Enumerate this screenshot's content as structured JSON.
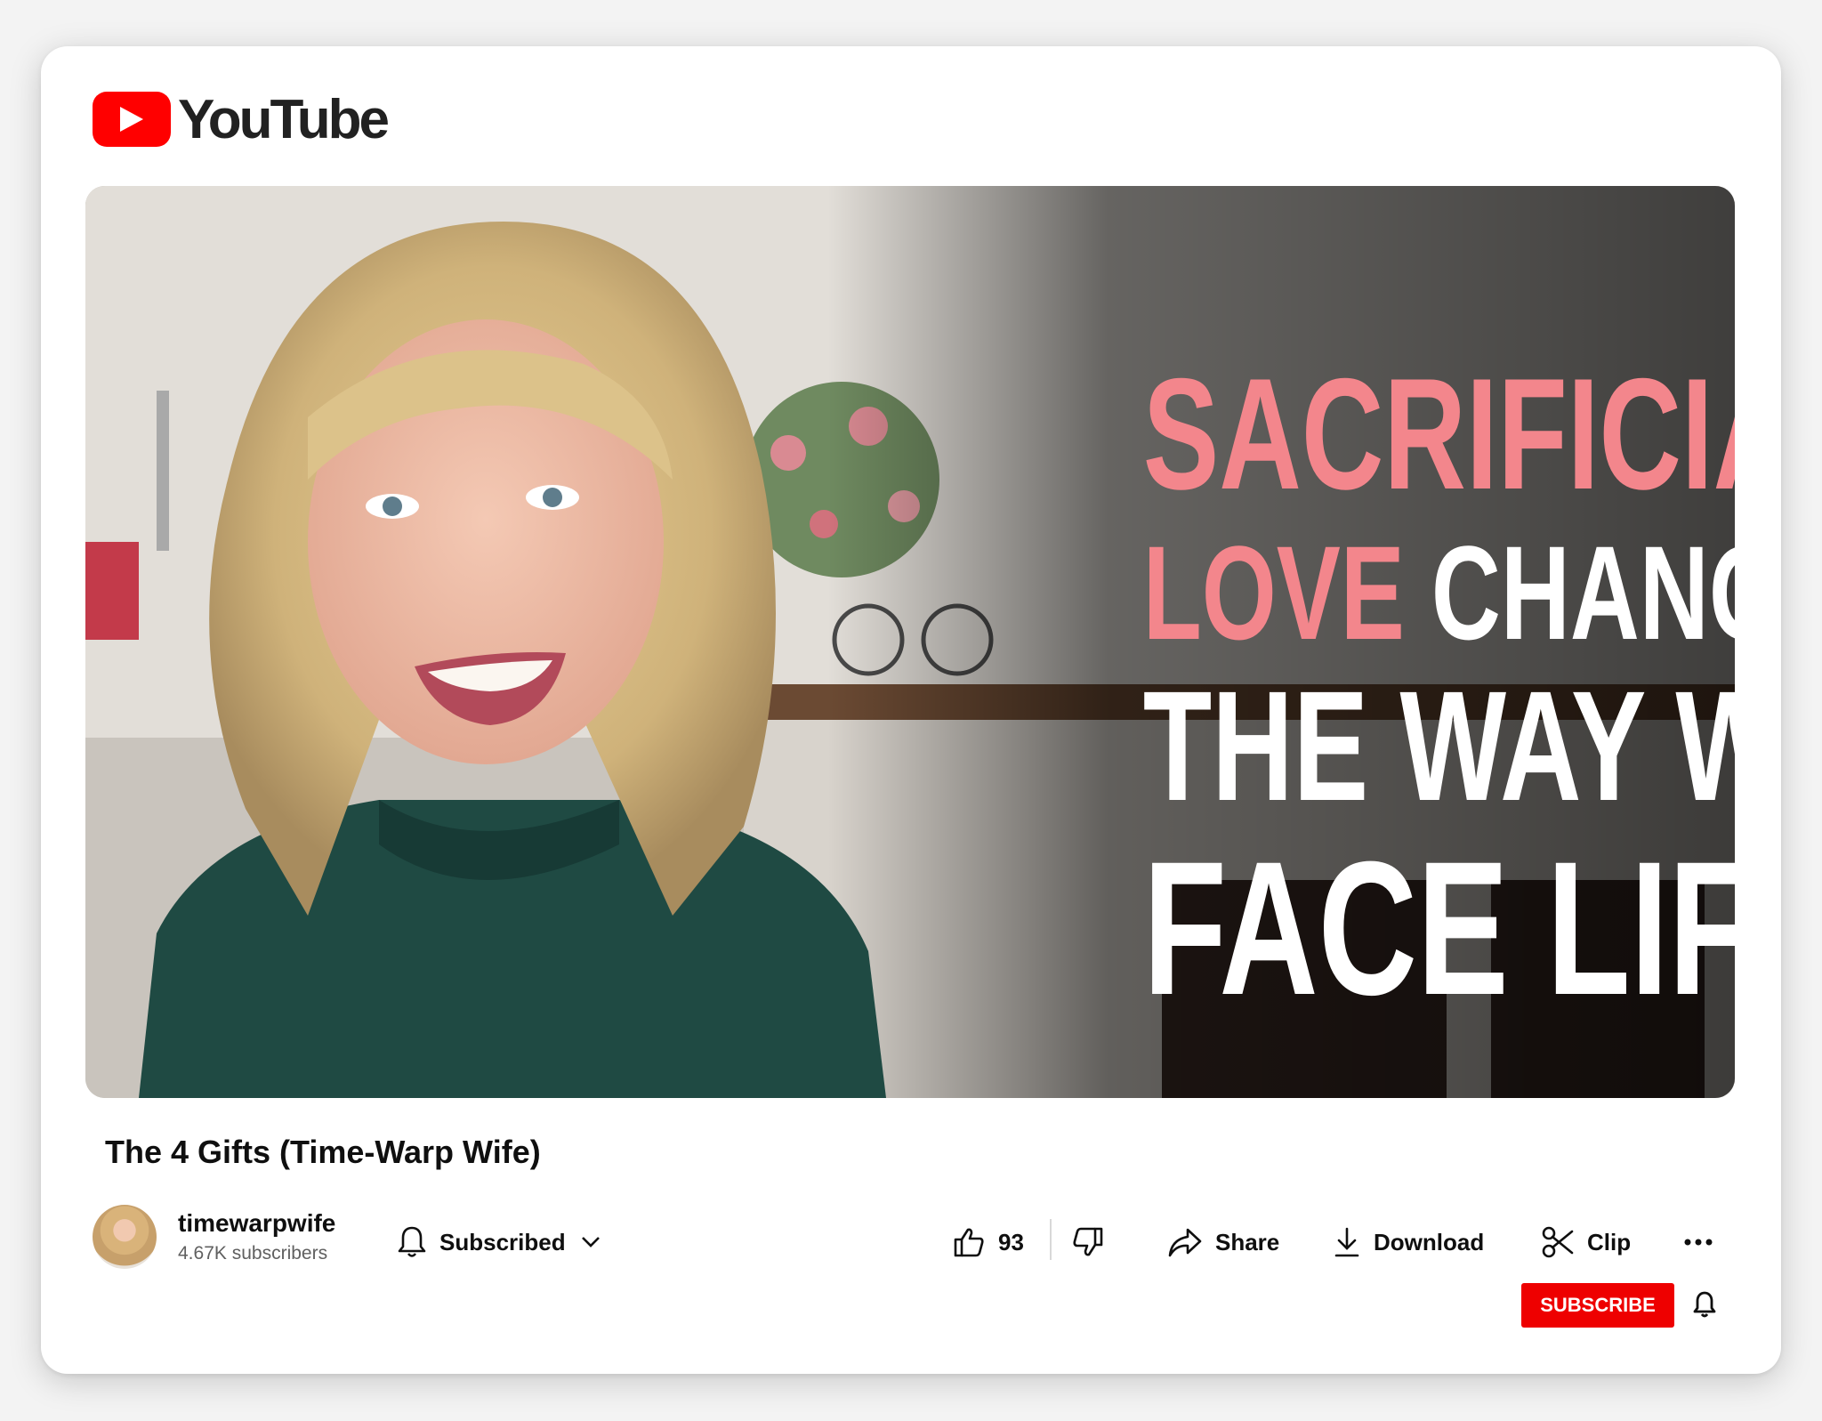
{
  "brand": {
    "name": "YouTube",
    "logo_icon": "youtube-play-icon",
    "accent": "#ff0000"
  },
  "thumbnail": {
    "headline": {
      "line1": "SACRIFICIAL",
      "line2_pink": "LOVE",
      "line2_white": "CHANGES",
      "line3": "THE WAY WE",
      "line4": "FACE LIFE"
    },
    "colors": {
      "pink": "#f3868c",
      "white": "#ffffff"
    }
  },
  "video": {
    "title": "The 4 Gifts (Time-Warp Wife)"
  },
  "channel": {
    "name": "timewarpwife",
    "subscribers": "4.67K subscribers"
  },
  "subscription": {
    "label": "Subscribed",
    "bell_icon": "bell-icon",
    "chevron_icon": "chevron-down-icon"
  },
  "actions": {
    "like_count": "93",
    "share_label": "Share",
    "download_label": "Download",
    "clip_label": "Clip"
  },
  "subscribe_button": {
    "label": "SUBSCRIBE",
    "color": "#ee0000"
  }
}
